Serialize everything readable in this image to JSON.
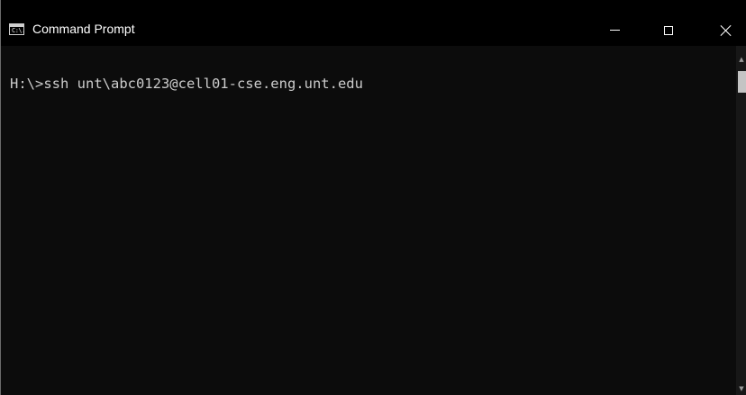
{
  "window": {
    "title": "Command Prompt",
    "icon": "cmd-icon",
    "icon_text": "C:\\."
  },
  "controls": {
    "minimize_icon": "minimize-icon",
    "maximize_icon": "maximize-icon",
    "close_icon": "close-icon"
  },
  "console": {
    "lines": [
      "H:\\>ssh unt\\abc0123@cell01-cse.eng.unt.edu"
    ]
  },
  "colors": {
    "background": "#0c0c0c",
    "text": "#cccccc",
    "titlebar": "#000000"
  }
}
